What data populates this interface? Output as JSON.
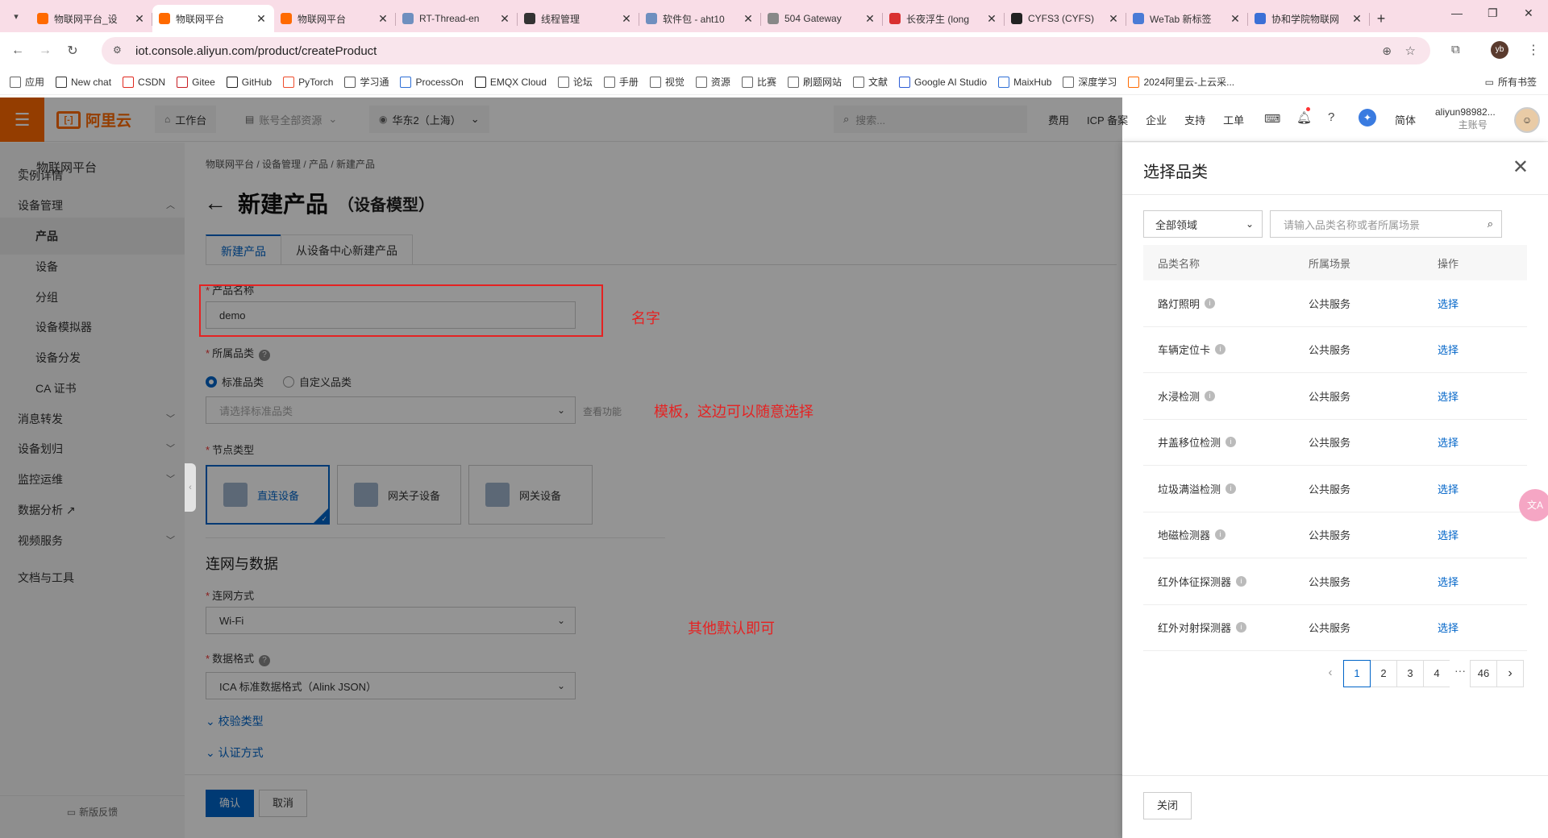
{
  "browser": {
    "tabs": [
      {
        "title": "物联网平台_设",
        "fav": "#ff6a00",
        "active": false
      },
      {
        "title": "物联网平台",
        "fav": "#ff6a00",
        "active": true
      },
      {
        "title": "物联网平台",
        "fav": "#ff6a00",
        "active": false
      },
      {
        "title": "RT-Thread-en",
        "fav": "#6f8fbf",
        "active": false
      },
      {
        "title": "线程管理",
        "fav": "#333333",
        "active": false
      },
      {
        "title": "软件包 - aht10",
        "fav": "#6f8fbf",
        "active": false
      },
      {
        "title": "504 Gateway",
        "fav": "#888888",
        "active": false
      },
      {
        "title": "长夜浮生 (long",
        "fav": "#d93030",
        "active": false
      },
      {
        "title": "CYFS3 (CYFS)",
        "fav": "#222222",
        "active": false
      },
      {
        "title": "WeTab 新标签",
        "fav": "#4a7bd6",
        "active": false
      },
      {
        "title": "协和学院物联网",
        "fav": "#3b6fd6",
        "active": false
      }
    ],
    "url": "iot.console.aliyun.com/product/createProduct",
    "bookmarks": [
      "应用",
      "New chat",
      "CSDN",
      "Gitee",
      "GitHub",
      "PyTorch",
      "学习通",
      "ProcessOn",
      "EMQX Cloud",
      "论坛",
      "手册",
      "视觉",
      "资源",
      "比赛",
      "刷题网站",
      "文献",
      "Google AI Studio",
      "MaixHub",
      "深度学习",
      "2024阿里云-上云采..."
    ],
    "bookmarks_right": "所有书签"
  },
  "console": {
    "logo": "阿里云",
    "workbench": "工作台",
    "account": "账号全部资源",
    "region": "华东2（上海）",
    "search_placeholder": "搜索...",
    "links": [
      "费用",
      "ICP 备案",
      "企业",
      "支持",
      "工单"
    ],
    "lang": "简体",
    "username": "aliyun98982...",
    "userrole": "主账号",
    "avatar_text": "yb"
  },
  "sidebar": {
    "title": "物联网平台",
    "items": [
      {
        "label": "实例详情",
        "sub": false,
        "active": false,
        "chev": ""
      },
      {
        "label": "设备管理",
        "sub": false,
        "active": false,
        "chev": "︿"
      },
      {
        "label": "产品",
        "sub": true,
        "active": true,
        "chev": ""
      },
      {
        "label": "设备",
        "sub": true,
        "active": false,
        "chev": ""
      },
      {
        "label": "分组",
        "sub": true,
        "active": false,
        "chev": ""
      },
      {
        "label": "设备模拟器",
        "sub": true,
        "active": false,
        "chev": ""
      },
      {
        "label": "设备分发",
        "sub": true,
        "active": false,
        "chev": ""
      },
      {
        "label": "CA 证书",
        "sub": true,
        "active": false,
        "chev": ""
      },
      {
        "label": "消息转发",
        "sub": false,
        "active": false,
        "chev": "﹀"
      },
      {
        "label": "设备划归",
        "sub": false,
        "active": false,
        "chev": "﹀"
      },
      {
        "label": "监控运维",
        "sub": false,
        "active": false,
        "chev": "﹀"
      },
      {
        "label": "数据分析 ↗",
        "sub": false,
        "active": false,
        "chev": ""
      },
      {
        "label": "视频服务",
        "sub": false,
        "active": false,
        "chev": "﹀"
      },
      {
        "label": "文档与工具",
        "sub": false,
        "active": false,
        "chev": ""
      }
    ],
    "feedback": "新版反馈"
  },
  "main": {
    "breadcrumb": "物联网平台  /  设备管理  /  产品  /  新建产品",
    "title": "新建产品",
    "subtitle": "（设备模型）",
    "tabs": [
      "新建产品",
      "从设备中心新建产品"
    ],
    "name_label": "产品名称",
    "name_value": "demo",
    "category_label": "所属品类",
    "radio_standard": "标准品类",
    "radio_custom": "自定义品类",
    "category_placeholder": "请选择标准品类",
    "view_function": "查看功能",
    "node_label": "节点类型",
    "nodes": [
      "直连设备",
      "网关子设备",
      "网关设备"
    ],
    "section_network": "连网与数据",
    "network_label": "连网方式",
    "network_value": "Wi-Fi",
    "format_label": "数据格式",
    "format_value": "ICA 标准数据格式（Alink JSON）",
    "verify_type": "校验类型",
    "auth_method": "认证方式",
    "confirm": "确认",
    "cancel": "取消"
  },
  "annotations": {
    "name": "名字",
    "template": "模板，这边可以随意选择",
    "default": "其他默认即可"
  },
  "drawer": {
    "title": "选择品类",
    "domain_select": "全部领域",
    "search_placeholder": "请输入品类名称或者所属场景",
    "headers": [
      "品类名称",
      "所属场景",
      "操作"
    ],
    "rows": [
      {
        "name": "路灯照明",
        "scene": "公共服务",
        "action": "选择"
      },
      {
        "name": "车辆定位卡",
        "scene": "公共服务",
        "action": "选择"
      },
      {
        "name": "水浸检测",
        "scene": "公共服务",
        "action": "选择"
      },
      {
        "name": "井盖移位检测",
        "scene": "公共服务",
        "action": "选择"
      },
      {
        "name": "垃圾满溢检测",
        "scene": "公共服务",
        "action": "选择"
      },
      {
        "name": "地磁检测器",
        "scene": "公共服务",
        "action": "选择"
      },
      {
        "name": "红外体征探测器",
        "scene": "公共服务",
        "action": "选择"
      },
      {
        "name": "红外对射探测器",
        "scene": "公共服务",
        "action": "选择"
      }
    ],
    "pages": [
      "1",
      "2",
      "3",
      "4",
      "···",
      "46"
    ],
    "close": "关闭"
  },
  "colors": {
    "brand": "#ff6a00",
    "primary": "#0064c8",
    "annotation": "#e52222"
  }
}
